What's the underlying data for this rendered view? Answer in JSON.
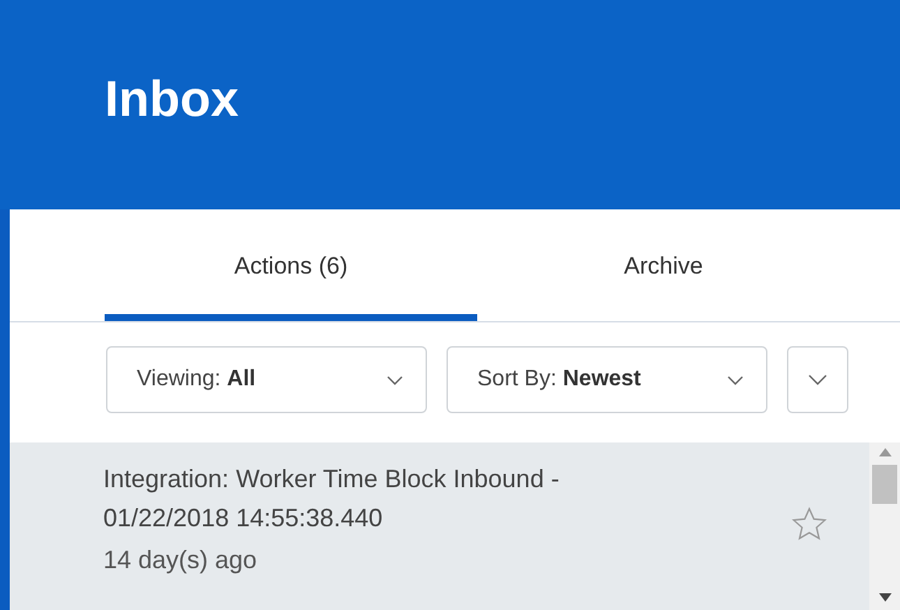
{
  "header": {
    "title": "Inbox"
  },
  "tabs": [
    {
      "label": "Actions (6)",
      "selected": true
    },
    {
      "label": "Archive",
      "selected": false
    }
  ],
  "filters": [
    {
      "label": "Viewing:",
      "value": "All"
    },
    {
      "label": "Sort By:",
      "value": "Newest"
    }
  ],
  "items": [
    {
      "title": "Integration: Worker Time Block Inbound - 01/22/2018 14:55:38.440",
      "age": "14 day(s) ago",
      "starred": false,
      "selected": true
    }
  ]
}
